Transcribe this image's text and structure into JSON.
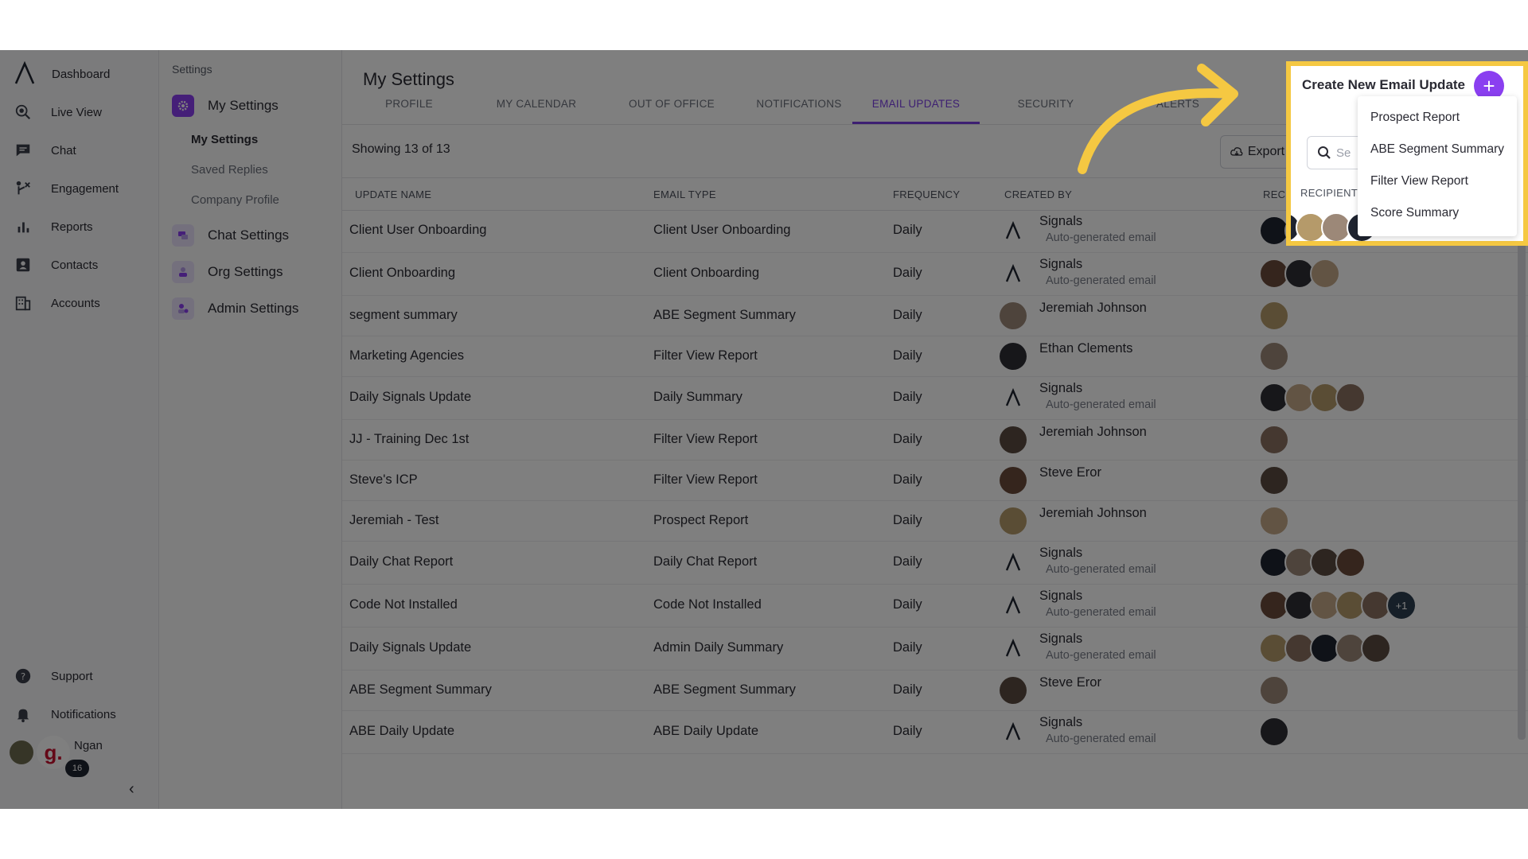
{
  "nav": {
    "items": [
      {
        "label": "Dashboard",
        "icon": "lambda-logo-icon"
      },
      {
        "label": "Live View",
        "icon": "live-view-icon"
      },
      {
        "label": "Chat",
        "icon": "chat-icon"
      },
      {
        "label": "Engagement",
        "icon": "engagement-icon"
      },
      {
        "label": "Reports",
        "icon": "reports-icon"
      },
      {
        "label": "Contacts",
        "icon": "contacts-icon"
      },
      {
        "label": "Accounts",
        "icon": "accounts-icon"
      }
    ],
    "bottom": [
      {
        "label": "Support",
        "icon": "help-icon"
      },
      {
        "label": "Notifications",
        "icon": "bell-icon"
      }
    ],
    "user_name": "Ngan",
    "badge": "16",
    "logo_letter": "g."
  },
  "settings_sidebar": {
    "heading": "Settings",
    "groups": [
      {
        "label": "My Settings",
        "color": "#8a3ff0"
      },
      {
        "label": "Chat Settings",
        "color": "#b59ae8"
      },
      {
        "label": "Org Settings",
        "color": "#b59ae8"
      },
      {
        "label": "Admin Settings",
        "color": "#b59ae8"
      }
    ],
    "sub_items": [
      "My Settings",
      "Saved Replies",
      "Company Profile"
    ]
  },
  "main": {
    "title": "My Settings",
    "tabs": [
      "PROFILE",
      "MY CALENDAR",
      "OUT OF OFFICE",
      "NOTIFICATIONS",
      "EMAIL UPDATES",
      "SECURITY",
      "ALERTS"
    ],
    "active_tab": "EMAIL UPDATES",
    "showing": "Showing 13 of 13",
    "export_label": "Export",
    "columns": [
      "UPDATE NAME",
      "EMAIL TYPE",
      "FREQUENCY",
      "CREATED BY",
      "RECIPIENTS"
    ],
    "rows": [
      {
        "name": "Client User Onboarding",
        "type": "Client User Onboarding",
        "freq": "Daily",
        "creator": "Signals",
        "sub": "Auto-generated email",
        "recips": 4
      },
      {
        "name": "Client Onboarding",
        "type": "Client Onboarding",
        "freq": "Daily",
        "creator": "Signals",
        "sub": "Auto-generated email",
        "recips": 3
      },
      {
        "name": "segment summary",
        "type": "ABE Segment Summary",
        "freq": "Daily",
        "creator": "Jeremiah Johnson",
        "sub": "",
        "recips": 1
      },
      {
        "name": "Marketing Agencies",
        "type": "Filter View Report",
        "freq": "Daily",
        "creator": "Ethan Clements",
        "sub": "",
        "recips": 1
      },
      {
        "name": "Daily Signals Update",
        "type": "Daily Summary",
        "freq": "Daily",
        "creator": "Signals",
        "sub": "Auto-generated email",
        "recips": 4
      },
      {
        "name": "JJ - Training Dec 1st",
        "type": "Filter View Report",
        "freq": "Daily",
        "creator": "Jeremiah Johnson",
        "sub": "",
        "recips": 1
      },
      {
        "name": "Steve's ICP",
        "type": "Filter View Report",
        "freq": "Daily",
        "creator": "Steve Eror",
        "sub": "",
        "recips": 1
      },
      {
        "name": "Jeremiah - Test",
        "type": "Prospect Report",
        "freq": "Daily",
        "creator": "Jeremiah Johnson",
        "sub": "",
        "recips": 1
      },
      {
        "name": "Daily Chat Report",
        "type": "Daily Chat Report",
        "freq": "Daily",
        "creator": "Signals",
        "sub": "Auto-generated email",
        "recips": 4
      },
      {
        "name": "Code Not Installed",
        "type": "Code Not Installed",
        "freq": "Daily",
        "creator": "Signals",
        "sub": "Auto-generated email",
        "recips": 5,
        "more": "+1"
      },
      {
        "name": "Daily Signals Update",
        "type": "Admin Daily Summary",
        "freq": "Daily",
        "creator": "Signals",
        "sub": "Auto-generated email",
        "recips": 5
      },
      {
        "name": "ABE Segment Summary",
        "type": "ABE Segment Summary",
        "freq": "Daily",
        "creator": "Steve Eror",
        "sub": "",
        "recips": 1
      },
      {
        "name": "ABE Daily Update",
        "type": "ABE Daily Update",
        "freq": "Daily",
        "creator": "Signals",
        "sub": "Auto-generated email",
        "recips": 1
      }
    ]
  },
  "popup": {
    "title": "Create New Email Update",
    "plus": "+",
    "search_placeholder": "Se",
    "recipients_header": "RECIPIENTS",
    "menu": [
      "Prospect Report",
      "ABE Segment Summary",
      "Filter View Report",
      "Score Summary"
    ]
  },
  "colors": {
    "accent": "#8a3ff0",
    "highlight": "#f5c842",
    "overlay": "rgba(0,0,0,0.5)"
  }
}
